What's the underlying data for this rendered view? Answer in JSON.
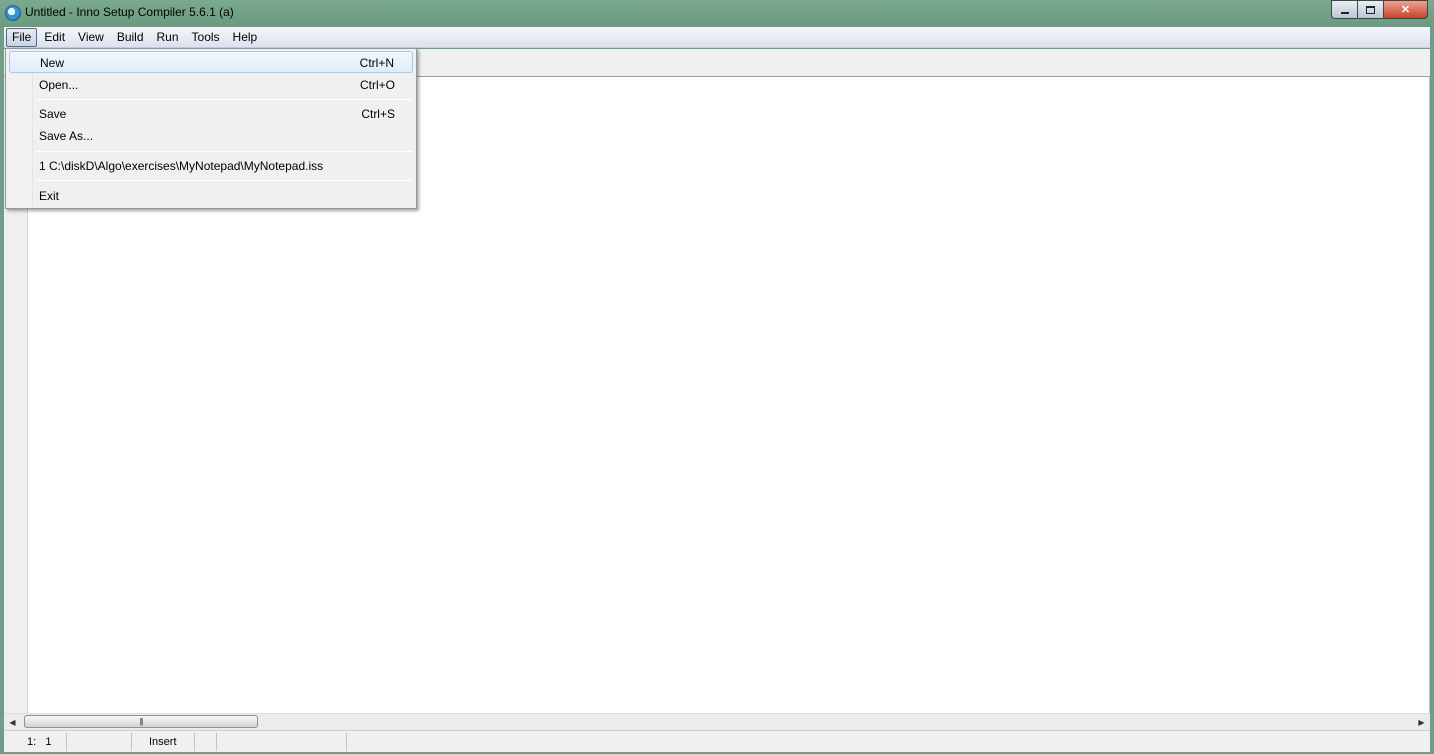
{
  "window": {
    "title": "Untitled - Inno Setup Compiler 5.6.1 (a)",
    "buttons": {
      "minimize": "minimize",
      "maximize": "maximize",
      "close": "close"
    }
  },
  "menubar": {
    "items": [
      "File",
      "Edit",
      "View",
      "Build",
      "Run",
      "Tools",
      "Help"
    ],
    "active": "File"
  },
  "file_menu": {
    "new": {
      "label": "New",
      "shortcut": "Ctrl+N"
    },
    "open": {
      "label": "Open...",
      "shortcut": "Ctrl+O"
    },
    "save": {
      "label": "Save",
      "shortcut": "Ctrl+S"
    },
    "save_as": {
      "label": "Save As..."
    },
    "recent_1": {
      "label": "1 C:\\diskD\\Algo\\exercises\\MyNotepad\\MyNotepad.iss"
    },
    "exit": {
      "label": "Exit"
    }
  },
  "statusbar": {
    "position": "1:   1",
    "mode": "Insert"
  },
  "colors": {
    "titlebar": "#6e9f86",
    "menu_highlight": "#a8c8ef"
  },
  "icons": {
    "app": "inno-setup-icon",
    "scroll_left": "scroll-left-arrow-icon",
    "scroll_right": "scroll-right-arrow-icon"
  }
}
